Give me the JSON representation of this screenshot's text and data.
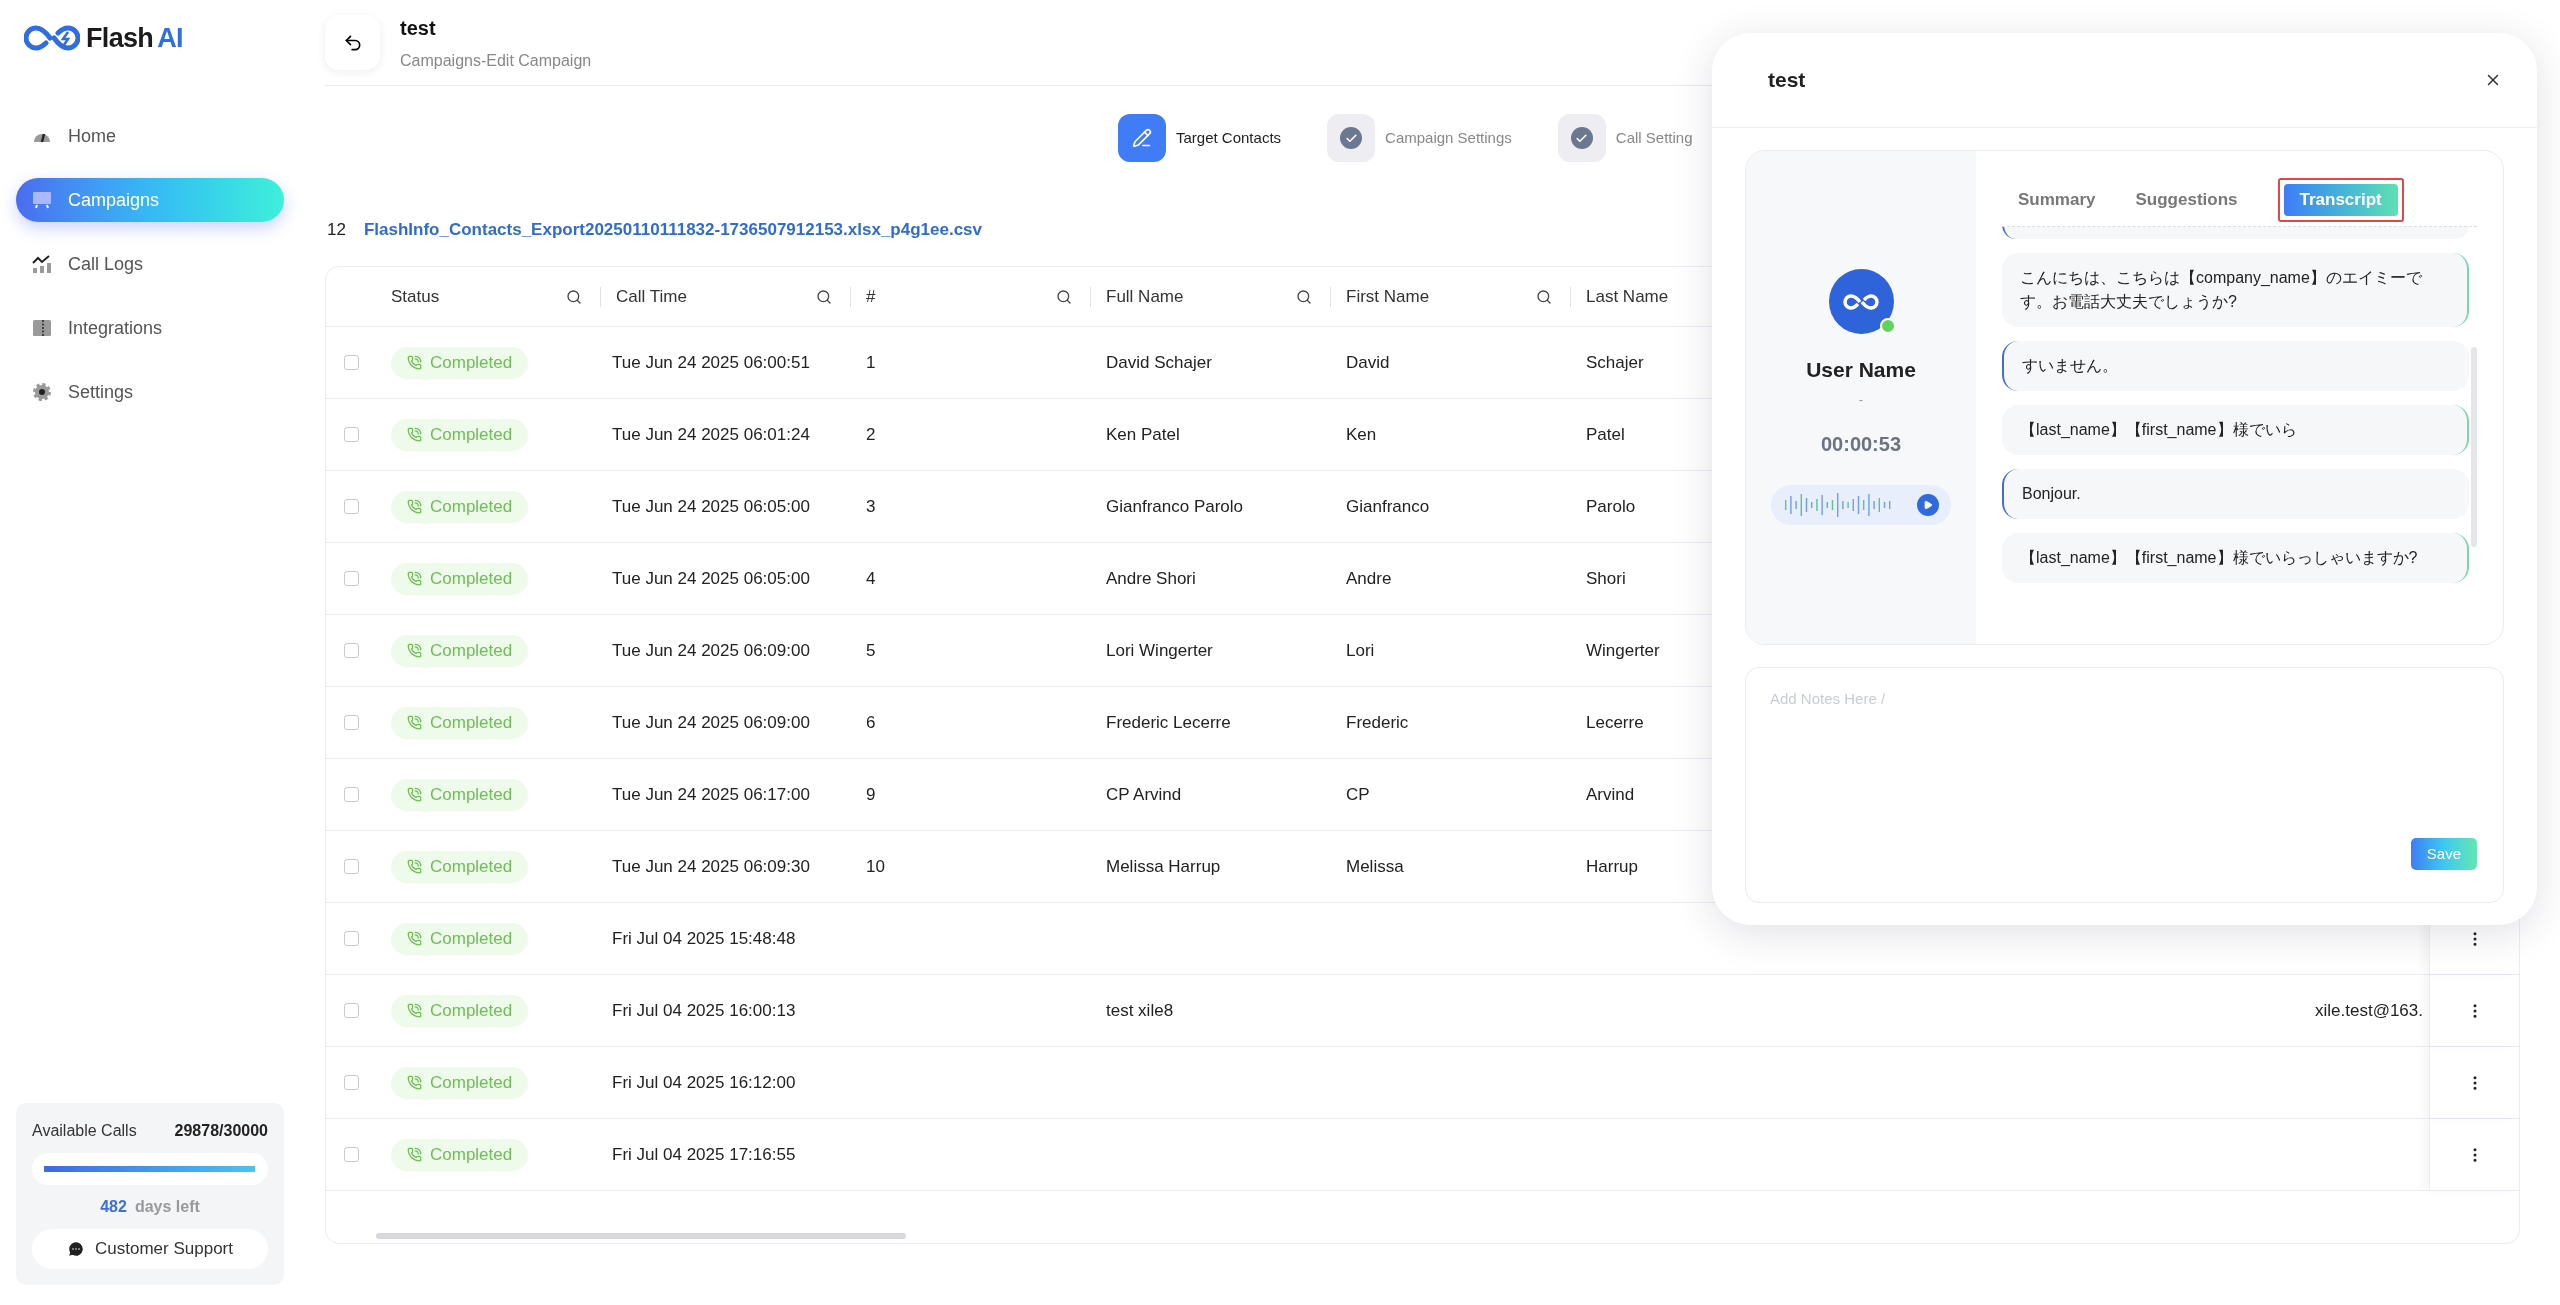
{
  "logo": {
    "text": "Flash",
    "accent": "AI"
  },
  "sidebar": {
    "items": [
      {
        "label": "Home",
        "selected": false
      },
      {
        "label": "Campaigns",
        "selected": true
      },
      {
        "label": "Call Logs",
        "selected": false
      },
      {
        "label": "Integrations",
        "selected": false
      },
      {
        "label": "Settings",
        "selected": false
      }
    ],
    "quota": {
      "label": "Available Calls",
      "value": "29878/30000",
      "level": 0.996,
      "days": "482",
      "days_label": "days left"
    },
    "support_button": "Customer Support"
  },
  "header": {
    "title": "test",
    "breadcrumb": "Campaigns-Edit Campaign"
  },
  "steps": [
    {
      "label": "Target Contacts",
      "selected": true
    },
    {
      "label": "Campaign Settings",
      "selected": false
    },
    {
      "label": "Call Setting",
      "selected": false
    }
  ],
  "file": {
    "count": "12",
    "name": "FlashInfo_Contacts_Export20250110111832-1736507912153.xlsx_p4g1ee.csv"
  },
  "table": {
    "columns": [
      {
        "label": "Status",
        "filter": true
      },
      {
        "label": "Call Time",
        "filter": true
      },
      {
        "label": "#",
        "filter": true
      },
      {
        "label": "Full Name",
        "filter": true
      },
      {
        "label": "First Name",
        "filter": true
      },
      {
        "label": "Last Name",
        "filter": false
      }
    ],
    "rows": [
      {
        "checked": false,
        "status": "Completed",
        "call_time": "Tue Jun 24 2025 06:00:51",
        "number": "1",
        "full_name": "David Schajer",
        "first_name": "David",
        "last_name": "Schajer"
      },
      {
        "checked": false,
        "status": "Completed",
        "call_time": "Tue Jun 24 2025 06:01:24",
        "number": "2",
        "full_name": "Ken Patel",
        "first_name": "Ken",
        "last_name": "Patel"
      },
      {
        "checked": false,
        "status": "Completed",
        "call_time": "Tue Jun 24 2025 06:05:00",
        "number": "3",
        "full_name": "Gianfranco Parolo",
        "first_name": "Gianfranco",
        "last_name": "Parolo"
      },
      {
        "checked": false,
        "status": "Completed",
        "call_time": "Tue Jun 24 2025 06:05:00",
        "number": "4",
        "full_name": "Andre Shori",
        "first_name": "Andre",
        "last_name": "Shori"
      },
      {
        "checked": false,
        "status": "Completed",
        "call_time": "Tue Jun 24 2025 06:09:00",
        "number": "5",
        "full_name": "Lori Wingerter",
        "first_name": "Lori",
        "last_name": "Wingerter"
      },
      {
        "checked": false,
        "status": "Completed",
        "call_time": "Tue Jun 24 2025 06:09:00",
        "number": "6",
        "full_name": "Frederic Lecerre",
        "first_name": "Frederic",
        "last_name": "Lecerre"
      },
      {
        "checked": false,
        "status": "Completed",
        "call_time": "Tue Jun 24 2025 06:17:00",
        "number": "9",
        "full_name": "CP Arvind",
        "first_name": "CP",
        "last_name": "Arvind"
      },
      {
        "checked": false,
        "status": "Completed",
        "call_time": "Tue Jun 24 2025 06:09:30",
        "number": "10",
        "full_name": "Melissa Harrup",
        "first_name": "Melissa",
        "last_name": "Harrup"
      },
      {
        "checked": false,
        "status": "Completed",
        "call_time": "Fri Jul 04 2025 15:48:48",
        "menu": true
      },
      {
        "checked": false,
        "status": "Completed",
        "call_time": "Fri Jul 04 2025 16:00:13",
        "full_name": "test xile8",
        "email": "xile.test@163.",
        "menu": true
      },
      {
        "checked": false,
        "status": "Completed",
        "call_time": "Fri Jul 04 2025 16:12:00",
        "menu": true
      },
      {
        "checked": false,
        "status": "Completed",
        "call_time": "Fri Jul 04 2025 17:16:55",
        "menu": true
      }
    ]
  },
  "dialog": {
    "title": "test",
    "contact": {
      "name": "User Name",
      "subtitle": "-",
      "duration": "00:00:53",
      "online": true
    },
    "tabs": [
      {
        "label": "Summary",
        "selected": false
      },
      {
        "label": "Suggestions",
        "selected": false
      },
      {
        "label": "Transcript",
        "selected": true
      }
    ],
    "messages": [
      {
        "kind": "agent",
        "text": "こんにちは、こちらは【company_name】のエイミーです。お電話大丈夫でしょうか?"
      },
      {
        "kind": "user",
        "text": "すいません。"
      },
      {
        "kind": "agent",
        "text": "【last_name】【first_name】様でいら"
      },
      {
        "kind": "user",
        "text": "Bonjour."
      },
      {
        "kind": "agent",
        "text": "【last_name】【first_name】様でいらっしゃいますか?"
      }
    ],
    "notes": {
      "placeholder": "Add Notes Here /"
    },
    "save_button": "Save"
  }
}
